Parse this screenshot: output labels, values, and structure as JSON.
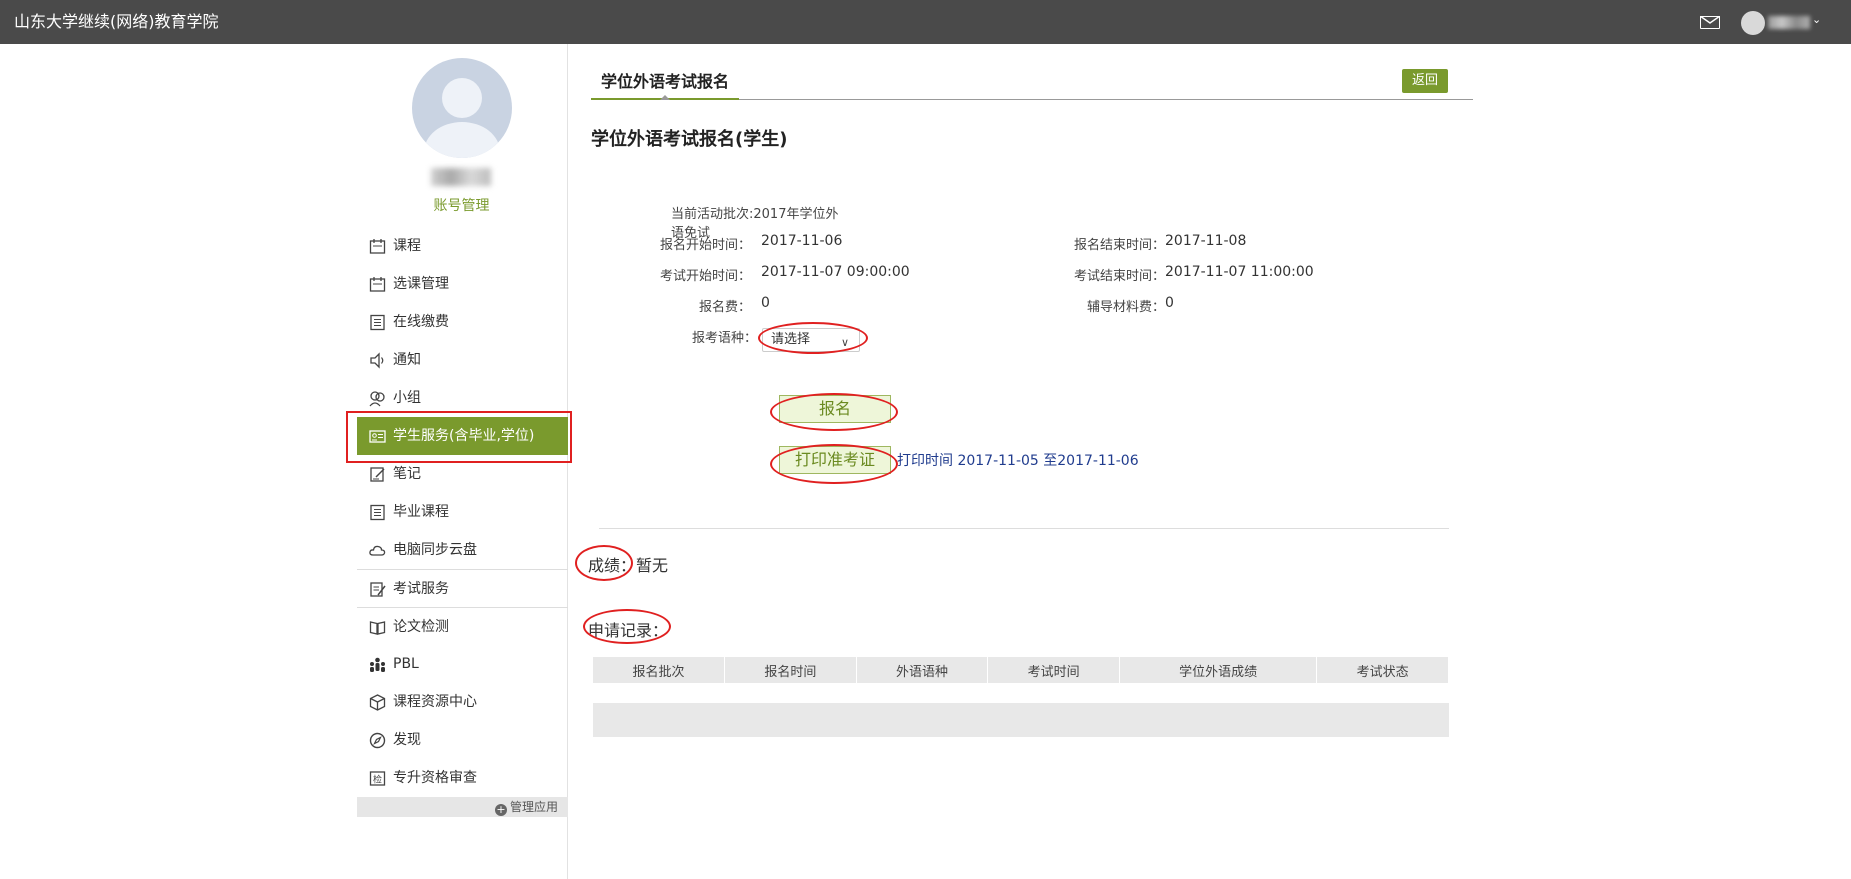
{
  "topbar": {
    "brand": "山东大学继续(网络)教育学院",
    "mail_icon": "mail-icon",
    "user_caret": "⌄"
  },
  "sidebar": {
    "account_link": "账号管理",
    "menu": [
      {
        "label": "课程",
        "icon": "calendar-icon"
      },
      {
        "label": "选课管理",
        "icon": "calendar-icon"
      },
      {
        "label": "在线缴费",
        "icon": "list-icon"
      },
      {
        "label": "通知",
        "icon": "speaker-icon"
      },
      {
        "label": "小组",
        "icon": "group-icon"
      },
      {
        "label": "学生服务(含毕业,学位)",
        "icon": "id-card-icon",
        "active": true
      },
      {
        "label": "笔记",
        "icon": "note-icon"
      },
      {
        "label": "毕业课程",
        "icon": "list-icon"
      },
      {
        "label": "电脑同步云盘",
        "icon": "cloud-icon"
      },
      {
        "label": "考试服务",
        "icon": "exam-icon"
      },
      {
        "label": "论文检测",
        "icon": "book-icon"
      },
      {
        "label": "PBL",
        "icon": "people-icon"
      },
      {
        "label": "课程资源中心",
        "icon": "cube-icon"
      },
      {
        "label": "发现",
        "icon": "compass-icon"
      },
      {
        "label": "专升资格审查",
        "icon": "check-icon"
      }
    ],
    "manage_apps": "管理应用"
  },
  "content": {
    "tab_label": "学位外语考试报名",
    "back_button": "返回",
    "page_title": "学位外语考试报名(学生)",
    "info": {
      "batch_label": "当前活动批次:",
      "batch_value": "2017年学位外语免试",
      "reg_start_label": "报名开始时间：",
      "reg_start_value": "2017-11-06",
      "reg_end_label": "报名结束时间：",
      "reg_end_value": "2017-11-08",
      "exam_start_label": "考试开始时间：",
      "exam_start_value": "2017-11-07 09:00:00",
      "exam_end_label": "考试结束时间：",
      "exam_end_value": "2017-11-07 11:00:00",
      "fee_label": "报名费：",
      "fee_value": "0",
      "material_fee_label": "辅导材料费：",
      "material_fee_value": "0",
      "language_label": "报考语种：",
      "language_select_value": "请选择"
    },
    "register_button": "报名",
    "print_button": "打印准考证",
    "print_time": "打印时间 2017-11-05 至2017-11-06",
    "score_label": "成绩：暂无",
    "records_label": "申请记录：",
    "records_table": {
      "headers": [
        "报名批次",
        "报名时间",
        "外语语种",
        "考试时间",
        "学位外语成绩",
        "考试状态"
      ]
    }
  },
  "colors": {
    "accent": "#7a9a2d",
    "topbar": "#4a4a4a",
    "annotation": "#e02020"
  }
}
